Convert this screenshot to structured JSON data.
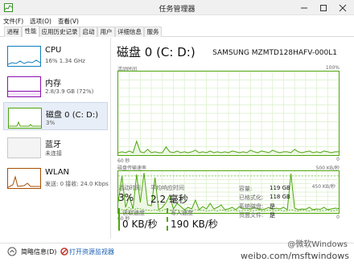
{
  "window": {
    "title": "任务管理器"
  },
  "menu": [
    "文件(F)",
    "选项(O)",
    "查看(V)"
  ],
  "tabs": [
    "进程",
    "性能",
    "应用历史记录",
    "启动",
    "用户",
    "详细信息",
    "服务"
  ],
  "active_tab": "性能",
  "sidebar": [
    {
      "title": "CPU",
      "sub": "16% 1.34 GHz",
      "color": "#117dbb"
    },
    {
      "title": "内存",
      "sub": "2.8/3.9 GB (72%)",
      "color": "#8b12ae"
    },
    {
      "title": "磁盘 0 (C: D:)",
      "sub": "3%",
      "color": "#4da60c"
    },
    {
      "title": "蓝牙",
      "sub": "未连接",
      "color": "#a0a0a0"
    },
    {
      "title": "WLAN",
      "sub": "发送: 0 接收: 24.0 Kbps",
      "color": "#a74f01"
    }
  ],
  "main": {
    "title": "磁盘 0 (C: D:)",
    "model": "SAMSUNG MZMTD128HAFV-000L1",
    "graph1": {
      "label": "活动时间",
      "max": "100%",
      "xleft": "60 秒",
      "xright": "0"
    },
    "graph2": {
      "label": "磁盘传输速率",
      "max": "500 KB/秒",
      "marker": "450 KB/秒",
      "xleft": "60 秒",
      "xright": "0"
    },
    "stats": {
      "active_label": "活动时间",
      "active_value": "3%",
      "resp_label": "平均响应时间",
      "resp_value": "2.2 毫秒",
      "read_label": "读取速度",
      "read_value": "0 KB/秒",
      "write_label": "写入速度",
      "write_value": "190 KB/秒"
    },
    "props": [
      {
        "k": "容量:",
        "v": "119 GB"
      },
      {
        "k": "已格式化:",
        "v": "118 GB"
      },
      {
        "k": "系统磁盘:",
        "v": "是"
      },
      {
        "k": "页面文件:",
        "v": "是"
      }
    ]
  },
  "footer": {
    "fewer": "简略信息(D)",
    "monitor": "打开资源监视器"
  },
  "watermark": {
    "line1": "@微软Windows",
    "line2": "weibo.com/msftwindows"
  },
  "chart_data": [
    {
      "type": "line",
      "title": "活动时间",
      "xlabel": "",
      "ylabel": "",
      "ylim": [
        0,
        100
      ],
      "series": [
        {
          "values": [
            2,
            3,
            2,
            4,
            2,
            16,
            3,
            2,
            6,
            2,
            3,
            2,
            2,
            9,
            3,
            2,
            4,
            2,
            3,
            2,
            3,
            5,
            2,
            3,
            2,
            4,
            2,
            3,
            2,
            3,
            2,
            4,
            3,
            2,
            3,
            2,
            5,
            3,
            2,
            4,
            3,
            2,
            5,
            3,
            2,
            3,
            3,
            2,
            6,
            3,
            2,
            3,
            4,
            2,
            3,
            2,
            4,
            3,
            2,
            3,
            3
          ]
        }
      ]
    },
    {
      "type": "line",
      "title": "磁盘传输速率",
      "xlabel": "",
      "ylabel": "",
      "ylim": [
        0,
        500
      ],
      "series": [
        {
          "values": [
            130,
            450,
            60,
            200,
            40,
            470,
            120,
            490,
            90,
            80,
            430,
            30,
            60,
            120,
            210,
            40,
            110,
            70,
            30,
            60,
            40,
            150,
            30,
            70,
            40,
            110,
            40,
            60,
            90,
            30,
            40,
            60,
            30,
            70,
            40,
            50,
            35,
            60,
            40,
            30,
            40,
            60,
            35,
            50,
            40,
            60,
            30,
            480,
            50,
            30,
            40,
            35,
            60,
            30,
            40,
            35,
            60,
            30,
            40,
            50,
            45
          ]
        },
        {
          "values": [
            40,
            30,
            20,
            60,
            15,
            50,
            40,
            30,
            25,
            20,
            30,
            15,
            20,
            40,
            25,
            20,
            30,
            15,
            20,
            25,
            15,
            30,
            20,
            25,
            15,
            20,
            25,
            15,
            30,
            20,
            15,
            25,
            20,
            15,
            20,
            25,
            15,
            20,
            25,
            15,
            20,
            25,
            15,
            20,
            25,
            15,
            20,
            30,
            20,
            15,
            25,
            20,
            15,
            25,
            20,
            15,
            20,
            25,
            15,
            20,
            30
          ]
        }
      ]
    }
  ]
}
